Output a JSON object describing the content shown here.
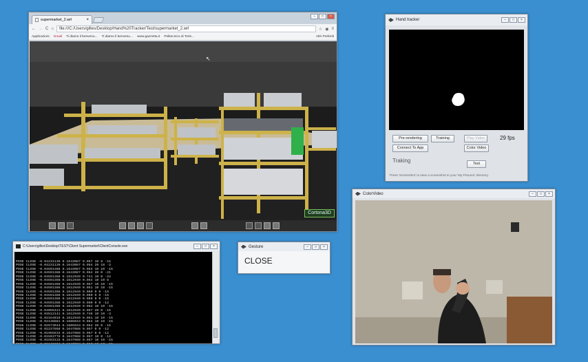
{
  "browser": {
    "tab_title": "supermarket_2.wrl",
    "url": "file:///C:/Users/gilles/Desktop/Hand%20Tracker/Test/supermarket_2.wrl",
    "bookmarks": [
      "Applicazioni",
      "Gmail",
      "Ti diamo il benvenu...",
      "Ti diamo il benvenu...",
      "www.gazzetta.it",
      "Politecnico di Torin..."
    ],
    "other_bookmarks": "Altri Preferiti",
    "viewer_logo": "Cortona3D"
  },
  "hand_tracker": {
    "title": "Hand tracker",
    "buttons": {
      "pre_rendering": "Pre-rendering",
      "training": "Training",
      "play_video": "Play Video",
      "connect": "Connect To App",
      "color_video": "Color Video",
      "test": "Test"
    },
    "fps": "29 fps",
    "status": "Traking",
    "hint": "Press 'Screenshot' to save a screenshot to your 'My Pictures' directory."
  },
  "console": {
    "title": "C:\\Users\\gilles\\Desktop\\TEST\\Client Supermarket\\ClientConsole.exe",
    "lines": [
      "POSE CLOSE -0.04231139 0.1643087 0.957 10 8 -15",
      "POSE CLOSE -0.04231139 0.1643087 0.954 20 10 -3",
      "POSE CLOSE -0.04591388 0.1643087 0.954 10 10 -15",
      "POSE CLOSE -0.04591388 0.1643087 0.954 20 0 -21",
      "POSE CLOSE -0.04591388 0.1612949 0.741 10 0 -24",
      "POSE CLOSE -0.04591388 0.1612949 0.954 10 10 6",
      "POSE CLOSE -0.04591388 0.1612949 0.957 10 10 -15",
      "POSE CLOSE -0.04591388 0.1612949 0.951 10 10 -15",
      "POSE CLOSE -0.04591388 0.1612949 0.960 0 0 -15",
      "POSE CLOSE -0.04591388 0.1612949 0.960 0 0 -15",
      "POSE CLOSE -0.04591388 0.1612949 0.960 0 0 -15",
      "POSE CLOSE -0.04591388 0.1612949 0.960 0 0 -12",
      "POSE CLOSE -0.04591388 0.1612949 0.962 10 10 -15",
      "POSE CLOSE -0.04055421 0.1612949 0.957 20 0 -15",
      "POSE CLOSE -0.03512141 0.1612949 0.746 10 10 -3",
      "POSE CLOSE -0.02154016 0.1612949 0.951 10 10 -15",
      "POSE CLOSE -0.02136881 0.1605043 0.954 10 10 -15",
      "POSE CLOSE -0.02673944 0.1605043 0.954 20 0 -15",
      "POSE CLOSE -0.02237868 0.1647088 0.957 0 0 -12",
      "POSE CLOSE -0.01955534 0.1647088 0.957 0 0 -12",
      "POSE CLOSE -0.01593778 0.1647088 0.957 10 0 -12",
      "POSE CLOSE -0.01593133 0.1647088 0.957 10 10 -15",
      "POSE CLOSE -0.01141604 0.1647088 0.957 10 10 -15",
      "POSE CLOSE -0.01141604 0.1647088 0.957 10 10 3"
    ]
  },
  "gesture": {
    "title": "Gesture",
    "value": "CLOSE"
  },
  "color_video": {
    "title": "ColorVideo"
  }
}
